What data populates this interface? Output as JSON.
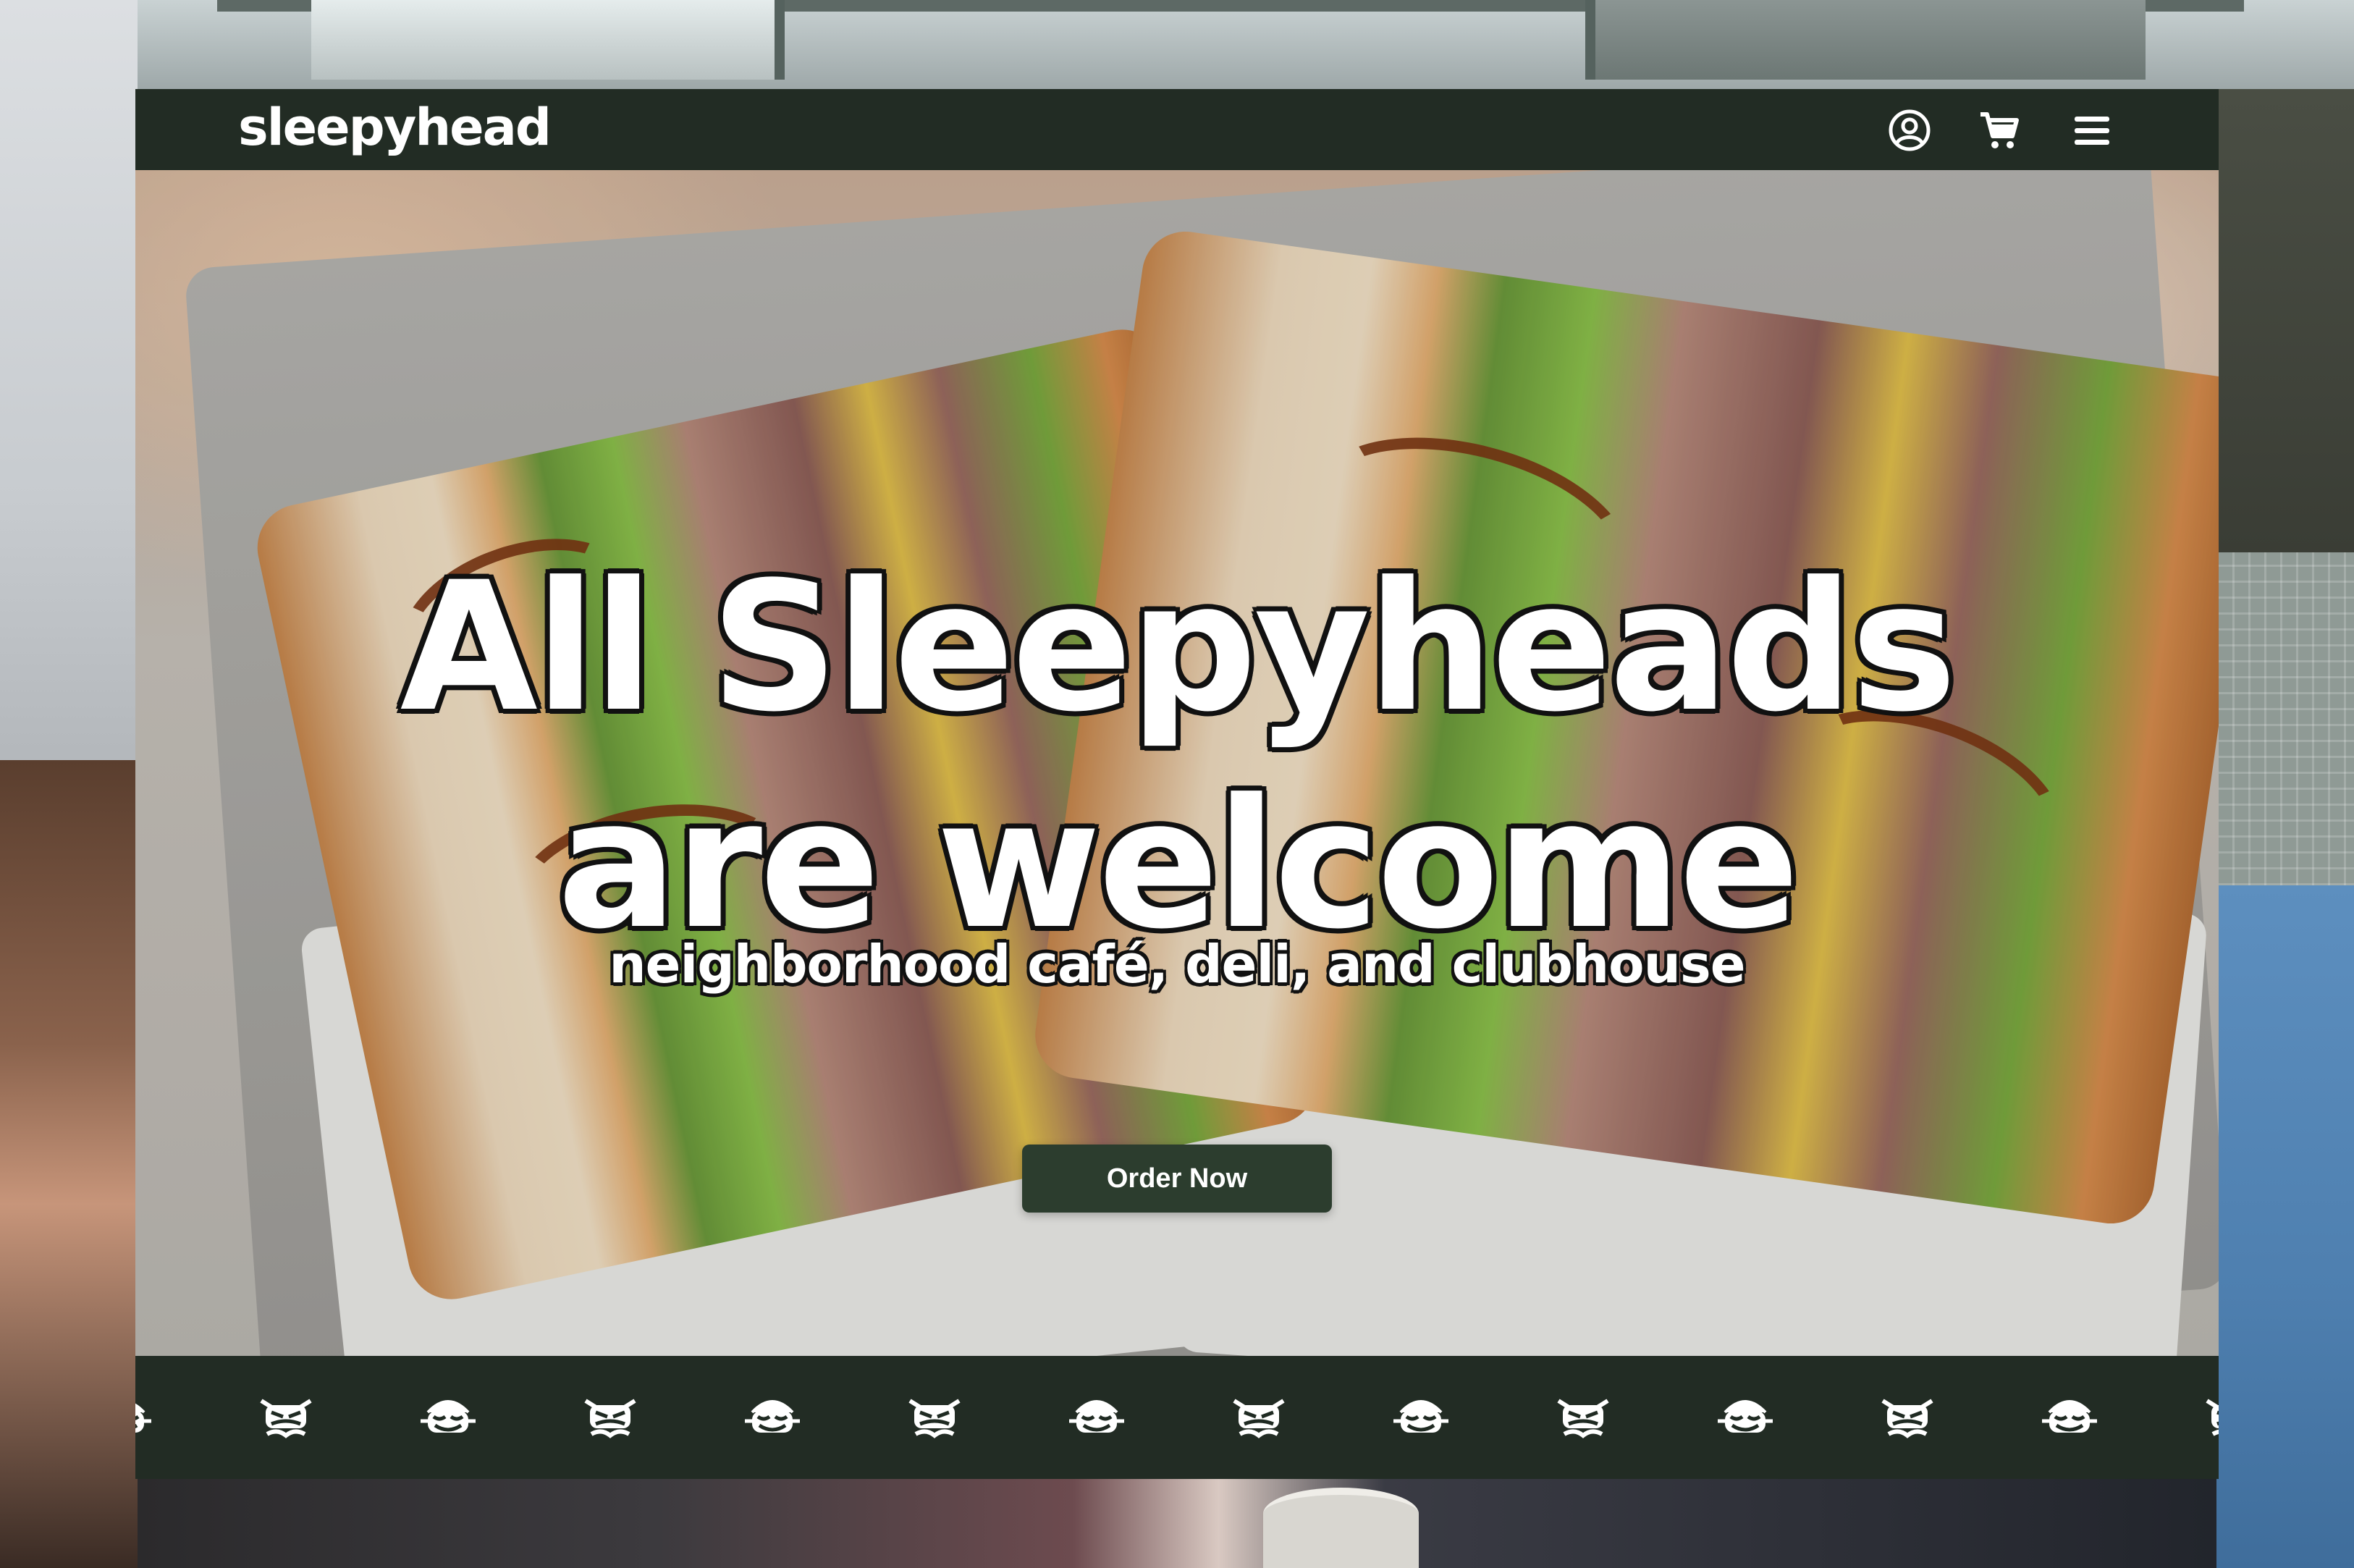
{
  "brand": {
    "name": "sleepyhead"
  },
  "nav": {
    "icons": [
      "account-icon",
      "cart-icon",
      "menu-icon"
    ]
  },
  "hero": {
    "headline_line1": "All Sleepyheads",
    "headline_line2": "are welcome",
    "subheadline": "neighborhood café, deli, and clubhouse",
    "cta_label": "Order Now"
  },
  "marquee": {
    "icons": [
      "smiling-face-icon",
      "winking-face-icon",
      "smiling-face-icon",
      "winking-face-icon",
      "smiling-face-icon",
      "winking-face-icon",
      "smiling-face-icon",
      "winking-face-icon",
      "smiling-face-icon",
      "winking-face-icon",
      "smiling-face-icon",
      "winking-face-icon",
      "smiling-face-icon",
      "winking-face-icon"
    ]
  },
  "colors": {
    "brand_dark_green": "#222c24",
    "cta_green": "#2c3d2e",
    "text_white": "#ffffff"
  }
}
